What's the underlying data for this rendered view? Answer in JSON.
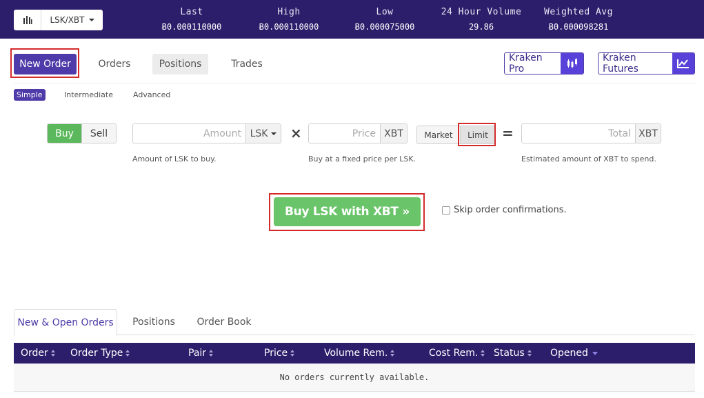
{
  "ticker": {
    "pair": "LSK/XBT",
    "stats": [
      {
        "label": "Last",
        "value": "Ƀ0.000110000"
      },
      {
        "label": "High",
        "value": "Ƀ0.000110000"
      },
      {
        "label": "Low",
        "value": "Ƀ0.000075000"
      },
      {
        "label": "24 Hour Volume",
        "value": "29.86"
      },
      {
        "label": "Weighted Avg",
        "value": "Ƀ0.000098281"
      }
    ]
  },
  "nav": {
    "tabs": [
      "New Order",
      "Orders",
      "Positions",
      "Trades"
    ],
    "kraken_pro": "Kraken Pro",
    "kraken_futures": "Kraken Futures"
  },
  "modes": [
    "Simple",
    "Intermediate",
    "Advanced"
  ],
  "form": {
    "buy": "Buy",
    "sell": "Sell",
    "amount_placeholder": "Amount",
    "amount_unit": "LSK",
    "amount_help": "Amount of LSK to buy.",
    "times": "×",
    "price_placeholder": "Price",
    "price_unit": "XBT",
    "price_help": "Buy at a fixed price per LSK.",
    "market": "Market",
    "limit": "Limit",
    "equals": "=",
    "total_placeholder": "Total",
    "total_unit": "XBT",
    "total_help": "Estimated amount of XBT to spend.",
    "submit": "Buy LSK with XBT »",
    "skip_confirm": "Skip order confirmations."
  },
  "bottom": {
    "tabs": [
      "New & Open Orders",
      "Positions",
      "Order Book"
    ],
    "columns": [
      "Order",
      "Order Type",
      "Pair",
      "Price",
      "Volume Rem.",
      "Cost Rem.",
      "Status",
      "Opened"
    ],
    "empty_message": "No orders currently available."
  },
  "colors": {
    "brand_dark": "#2d1e6b",
    "brand_purple": "#4e3aa8",
    "buy_green": "#5cb85c",
    "highlight_red": "#d42a2a"
  }
}
